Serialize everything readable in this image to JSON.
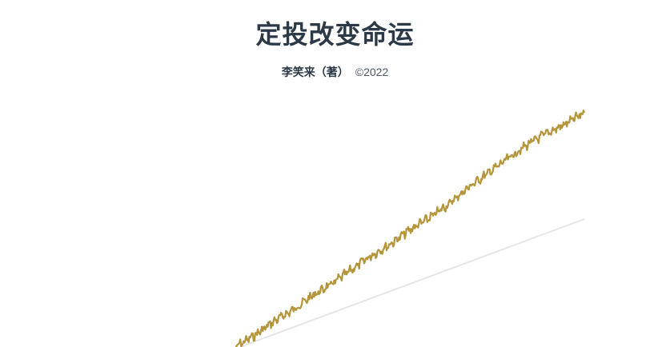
{
  "book": {
    "title": "定投改变命运",
    "author": "李笑来（著）",
    "copyright": "©2022"
  },
  "cover_art": {
    "growth_line_color": "#b5953a",
    "baseline_color": "#e6e6e6",
    "growth_levels": [
      0.0,
      0.05,
      0.11,
      0.16,
      0.22,
      0.27,
      0.33,
      0.39,
      0.44,
      0.5,
      0.55,
      0.61,
      0.68,
      0.74,
      0.8,
      0.86,
      0.91,
      0.95,
      1.0
    ],
    "baseline_end_level": 0.53
  }
}
